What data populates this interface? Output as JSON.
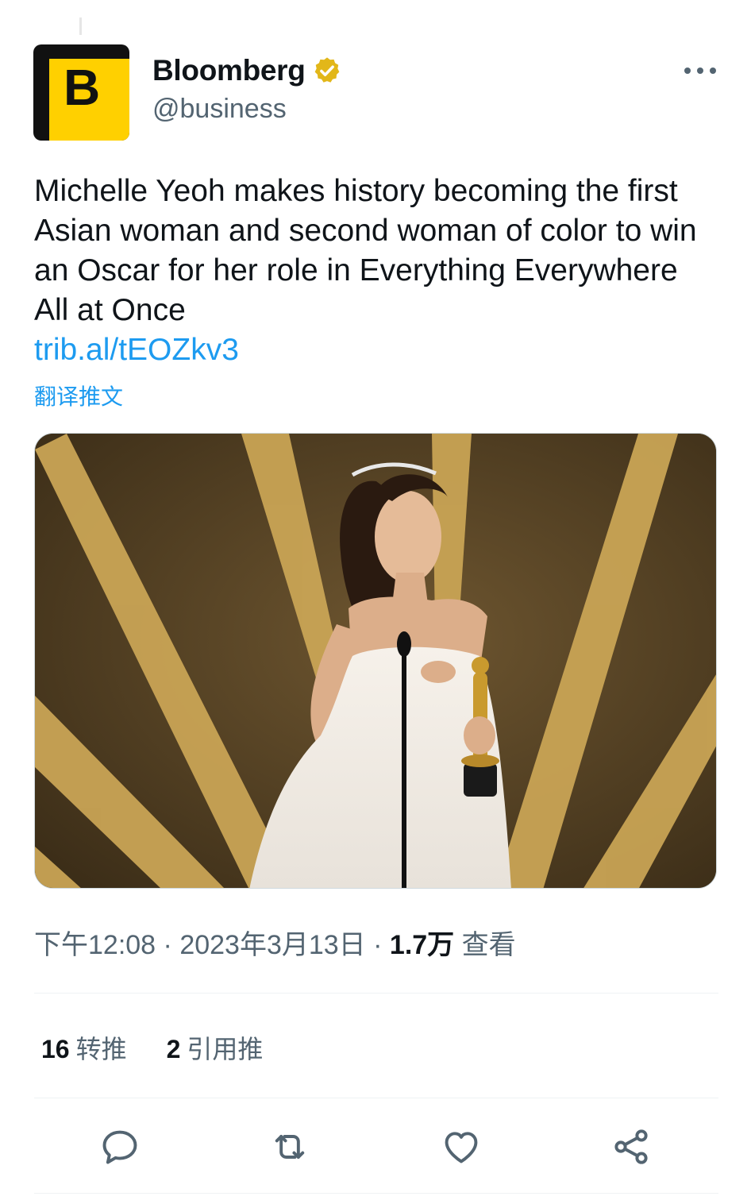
{
  "account": {
    "name": "Bloomberg",
    "handle": "@business",
    "avatar_letter": "B",
    "verified": true,
    "avatar_color": "#ffd000"
  },
  "tweet": {
    "text": "Michelle Yeoh makes history becoming the first Asian woman and second woman of color to win an Oscar for her role in Everything Everywhere All at Once",
    "link": "trib.al/tEOZkv3",
    "translate_label": "翻译推文"
  },
  "meta": {
    "time": "下午12:08",
    "sep1": " · ",
    "date": "2023年3月13日",
    "sep2": " · ",
    "views_count": "1.7万",
    "views_label": " 查看"
  },
  "stats": {
    "retweets_count": "16",
    "retweets_label": "转推",
    "quotes_count": "2",
    "quotes_label": "引用推"
  },
  "icons": {
    "more": "more-horizontal-icon",
    "reply": "reply-icon",
    "retweet": "retweet-icon",
    "like": "heart-icon",
    "share": "share-icon"
  },
  "colors": {
    "link": "#1d9bf0",
    "secondary_text": "#536471",
    "badge": "#e2b719"
  }
}
